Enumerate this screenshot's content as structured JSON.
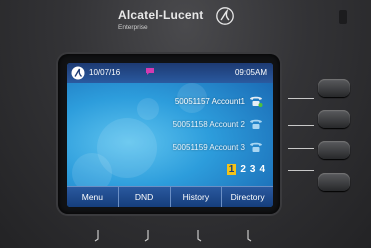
{
  "brand": {
    "name": "Alcatel-Lucent",
    "subtitle": "Enterprise"
  },
  "status": {
    "date": "10/07/16",
    "message_icon": "message-icon",
    "time": "09:05AM"
  },
  "lines": [
    {
      "label": "50051157 Account1",
      "icon": "handset-icon",
      "active": true
    },
    {
      "label": "50051158 Account 2",
      "icon": "handset-icon",
      "active": false
    },
    {
      "label": "50051159 Account 3",
      "icon": "handset-icon",
      "active": false
    }
  ],
  "pages": [
    "1",
    "2",
    "3",
    "4"
  ],
  "active_page": "1",
  "softkeys": [
    "Menu",
    "DND",
    "History",
    "Directory"
  ],
  "colors": {
    "accent": "#2d9ddc",
    "status_bar": "#1d3a72",
    "page_highlight": "#f2c318",
    "message_icon": "#d43ab0"
  }
}
